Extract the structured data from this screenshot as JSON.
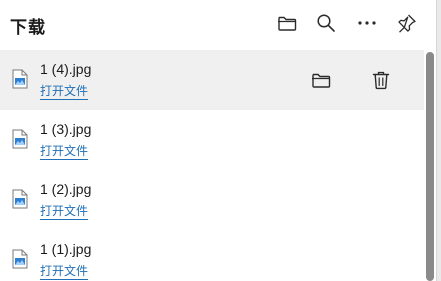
{
  "header": {
    "title": "下载",
    "icons": [
      "folder-icon",
      "search-icon",
      "more-icon",
      "pin-icon"
    ]
  },
  "downloads": [
    {
      "name": "1 (4).jpg",
      "action": "打开文件",
      "hovered": true
    },
    {
      "name": "1 (3).jpg",
      "action": "打开文件",
      "hovered": false
    },
    {
      "name": "1 (2).jpg",
      "action": "打开文件",
      "hovered": false
    },
    {
      "name": "1 (1).jpg",
      "action": "打开文件",
      "hovered": false
    }
  ],
  "item_actions": [
    "folder-icon",
    "trash-icon"
  ],
  "colors": {
    "link": "#1f6fb6",
    "hover_bg": "#f0f0f0",
    "scrollbar": "#8a8a8a"
  }
}
